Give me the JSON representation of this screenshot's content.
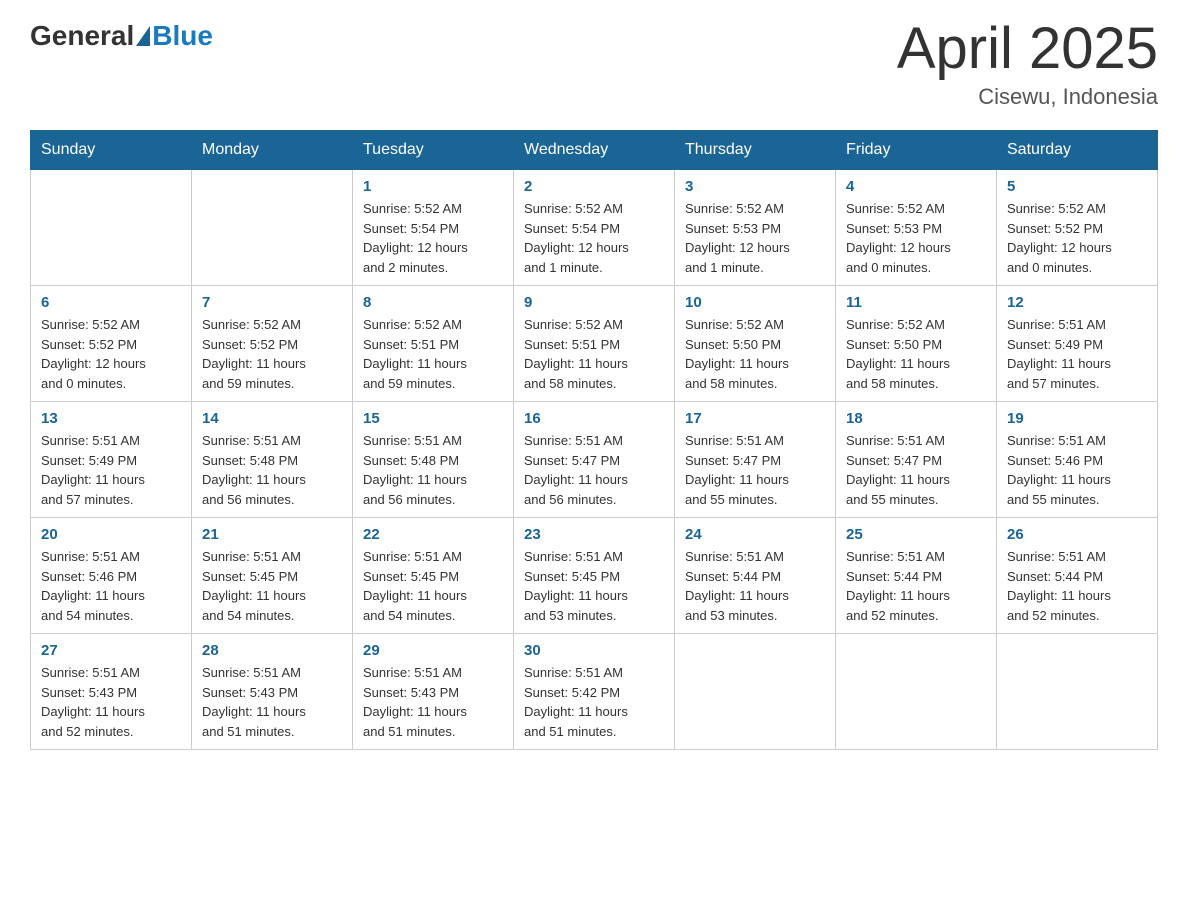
{
  "logo": {
    "general": "General",
    "blue": "Blue"
  },
  "title": "April 2025",
  "location": "Cisewu, Indonesia",
  "days_header": [
    "Sunday",
    "Monday",
    "Tuesday",
    "Wednesday",
    "Thursday",
    "Friday",
    "Saturday"
  ],
  "weeks": [
    [
      {
        "day": "",
        "info": ""
      },
      {
        "day": "",
        "info": ""
      },
      {
        "day": "1",
        "info": "Sunrise: 5:52 AM\nSunset: 5:54 PM\nDaylight: 12 hours\nand 2 minutes."
      },
      {
        "day": "2",
        "info": "Sunrise: 5:52 AM\nSunset: 5:54 PM\nDaylight: 12 hours\nand 1 minute."
      },
      {
        "day": "3",
        "info": "Sunrise: 5:52 AM\nSunset: 5:53 PM\nDaylight: 12 hours\nand 1 minute."
      },
      {
        "day": "4",
        "info": "Sunrise: 5:52 AM\nSunset: 5:53 PM\nDaylight: 12 hours\nand 0 minutes."
      },
      {
        "day": "5",
        "info": "Sunrise: 5:52 AM\nSunset: 5:52 PM\nDaylight: 12 hours\nand 0 minutes."
      }
    ],
    [
      {
        "day": "6",
        "info": "Sunrise: 5:52 AM\nSunset: 5:52 PM\nDaylight: 12 hours\nand 0 minutes."
      },
      {
        "day": "7",
        "info": "Sunrise: 5:52 AM\nSunset: 5:52 PM\nDaylight: 11 hours\nand 59 minutes."
      },
      {
        "day": "8",
        "info": "Sunrise: 5:52 AM\nSunset: 5:51 PM\nDaylight: 11 hours\nand 59 minutes."
      },
      {
        "day": "9",
        "info": "Sunrise: 5:52 AM\nSunset: 5:51 PM\nDaylight: 11 hours\nand 58 minutes."
      },
      {
        "day": "10",
        "info": "Sunrise: 5:52 AM\nSunset: 5:50 PM\nDaylight: 11 hours\nand 58 minutes."
      },
      {
        "day": "11",
        "info": "Sunrise: 5:52 AM\nSunset: 5:50 PM\nDaylight: 11 hours\nand 58 minutes."
      },
      {
        "day": "12",
        "info": "Sunrise: 5:51 AM\nSunset: 5:49 PM\nDaylight: 11 hours\nand 57 minutes."
      }
    ],
    [
      {
        "day": "13",
        "info": "Sunrise: 5:51 AM\nSunset: 5:49 PM\nDaylight: 11 hours\nand 57 minutes."
      },
      {
        "day": "14",
        "info": "Sunrise: 5:51 AM\nSunset: 5:48 PM\nDaylight: 11 hours\nand 56 minutes."
      },
      {
        "day": "15",
        "info": "Sunrise: 5:51 AM\nSunset: 5:48 PM\nDaylight: 11 hours\nand 56 minutes."
      },
      {
        "day": "16",
        "info": "Sunrise: 5:51 AM\nSunset: 5:47 PM\nDaylight: 11 hours\nand 56 minutes."
      },
      {
        "day": "17",
        "info": "Sunrise: 5:51 AM\nSunset: 5:47 PM\nDaylight: 11 hours\nand 55 minutes."
      },
      {
        "day": "18",
        "info": "Sunrise: 5:51 AM\nSunset: 5:47 PM\nDaylight: 11 hours\nand 55 minutes."
      },
      {
        "day": "19",
        "info": "Sunrise: 5:51 AM\nSunset: 5:46 PM\nDaylight: 11 hours\nand 55 minutes."
      }
    ],
    [
      {
        "day": "20",
        "info": "Sunrise: 5:51 AM\nSunset: 5:46 PM\nDaylight: 11 hours\nand 54 minutes."
      },
      {
        "day": "21",
        "info": "Sunrise: 5:51 AM\nSunset: 5:45 PM\nDaylight: 11 hours\nand 54 minutes."
      },
      {
        "day": "22",
        "info": "Sunrise: 5:51 AM\nSunset: 5:45 PM\nDaylight: 11 hours\nand 54 minutes."
      },
      {
        "day": "23",
        "info": "Sunrise: 5:51 AM\nSunset: 5:45 PM\nDaylight: 11 hours\nand 53 minutes."
      },
      {
        "day": "24",
        "info": "Sunrise: 5:51 AM\nSunset: 5:44 PM\nDaylight: 11 hours\nand 53 minutes."
      },
      {
        "day": "25",
        "info": "Sunrise: 5:51 AM\nSunset: 5:44 PM\nDaylight: 11 hours\nand 52 minutes."
      },
      {
        "day": "26",
        "info": "Sunrise: 5:51 AM\nSunset: 5:44 PM\nDaylight: 11 hours\nand 52 minutes."
      }
    ],
    [
      {
        "day": "27",
        "info": "Sunrise: 5:51 AM\nSunset: 5:43 PM\nDaylight: 11 hours\nand 52 minutes."
      },
      {
        "day": "28",
        "info": "Sunrise: 5:51 AM\nSunset: 5:43 PM\nDaylight: 11 hours\nand 51 minutes."
      },
      {
        "day": "29",
        "info": "Sunrise: 5:51 AM\nSunset: 5:43 PM\nDaylight: 11 hours\nand 51 minutes."
      },
      {
        "day": "30",
        "info": "Sunrise: 5:51 AM\nSunset: 5:42 PM\nDaylight: 11 hours\nand 51 minutes."
      },
      {
        "day": "",
        "info": ""
      },
      {
        "day": "",
        "info": ""
      },
      {
        "day": "",
        "info": ""
      }
    ]
  ]
}
